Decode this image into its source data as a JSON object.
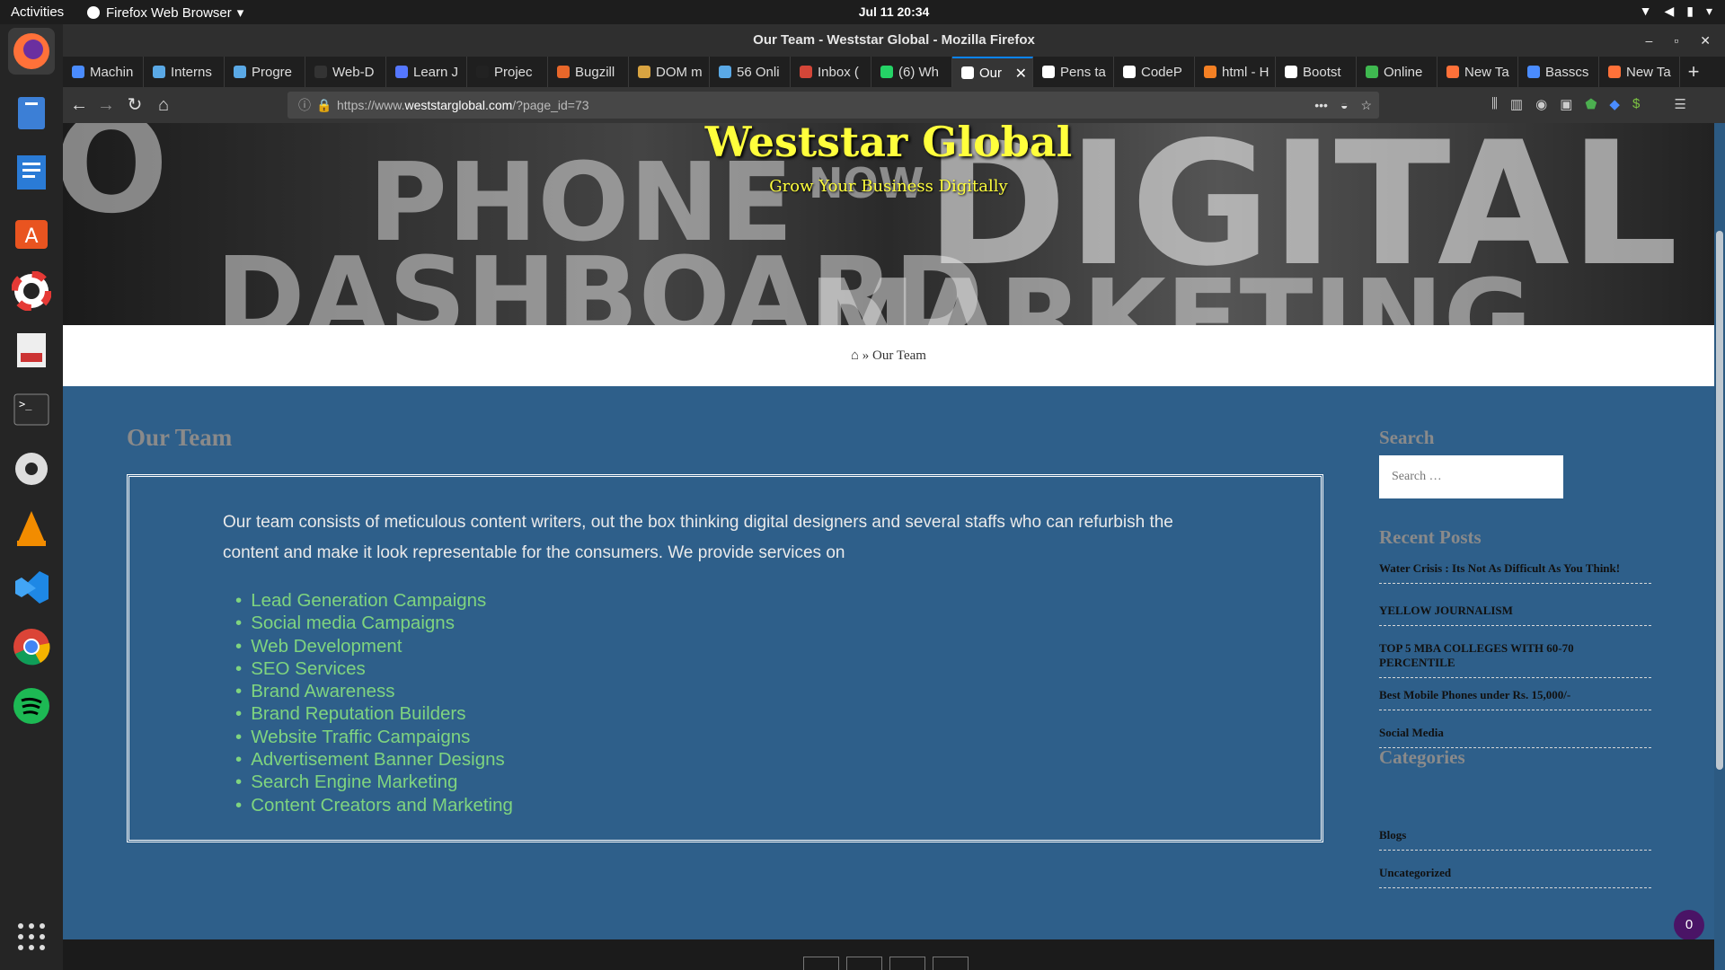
{
  "topbar": {
    "activities": "Activities",
    "app_name": "Firefox Web Browser",
    "clock": "Jul 11  20:34"
  },
  "dock": {
    "apps": [
      "firefox-icon",
      "files-icon",
      "writer-icon",
      "software-icon",
      "help-icon",
      "viewer-icon",
      "terminal-icon",
      "settings-icon",
      "vlc-icon",
      "vscode-icon",
      "chrome-icon",
      "spotify-icon",
      "apps-grid-icon"
    ]
  },
  "window": {
    "title": "Our Team - Weststar Global - Mozilla Firefox"
  },
  "tabs": [
    {
      "label": "Machin",
      "color": "#4a8cff"
    },
    {
      "label": "Interns",
      "color": "#5aa9e6"
    },
    {
      "label": "Progre",
      "color": "#5aa9e6"
    },
    {
      "label": "Web-D",
      "color": "#333333"
    },
    {
      "label": "Learn J",
      "color": "#5577ff"
    },
    {
      "label": "Projec",
      "color": "#222222"
    },
    {
      "label": "Bugzill",
      "color": "#e8672a"
    },
    {
      "label": "DOM m",
      "color": "#d9a441"
    },
    {
      "label": "56 Onli",
      "color": "#5aa9e6"
    },
    {
      "label": "Inbox (",
      "color": "#d44638"
    },
    {
      "label": "(6) Wh",
      "color": "#25d366"
    },
    {
      "label": "Our",
      "color": "#ffffff",
      "active": true
    },
    {
      "label": "Pens ta",
      "color": "#ffffff"
    },
    {
      "label": "CodeP",
      "color": "#ffffff"
    },
    {
      "label": "html - H",
      "color": "#f48024"
    },
    {
      "label": "Bootst",
      "color": "#ffffff"
    },
    {
      "label": "Online",
      "color": "#3fb950"
    },
    {
      "label": "New Ta",
      "color": "#ff7139"
    },
    {
      "label": "Basscs",
      "color": "#4a8cff"
    },
    {
      "label": "New Ta",
      "color": "#ff7139"
    }
  ],
  "address": {
    "prefix": "https://www.",
    "domain": "weststarglobal.com",
    "path": "/?page_id=73"
  },
  "site": {
    "title": "Weststar Global",
    "tagline": "Grow Your Business Digitally"
  },
  "breadcrumb": {
    "current": "Our Team"
  },
  "page": {
    "title": "Our Team",
    "intro": "Our team consists of meticulous content writers, out the box thinking digital designers and several staffs who can refurbish the content and make it look representable for the consumers. We provide services on",
    "services": [
      "Lead Generation Campaigns",
      "Social media Campaigns",
      "Web Development",
      "SEO Services",
      "Brand Awareness",
      "Brand Reputation Builders",
      "Website Traffic Campaigns",
      "Advertisement Banner Designs",
      "Search Engine Marketing",
      "Content Creators and Marketing"
    ]
  },
  "sidebar": {
    "search_heading": "Search",
    "search_placeholder": "Search …",
    "recent_heading": "Recent Posts",
    "recent": [
      "Water Crisis : Its Not As Difficult As You Think!",
      "YELLOW JOURNALISM",
      "TOP 5 MBA COLLEGES WITH 60-70 PERCENTILE",
      "Best Mobile Phones under Rs. 15,000/-",
      "Social Media"
    ],
    "categories_heading": "Categories",
    "categories": [
      "Blogs",
      "Uncategorized"
    ]
  },
  "cart": {
    "count": "0"
  },
  "colors": {
    "page_bg": "#2e5f8a",
    "title_yellow": "#ffff3c",
    "link_green": "#7fd47f"
  }
}
